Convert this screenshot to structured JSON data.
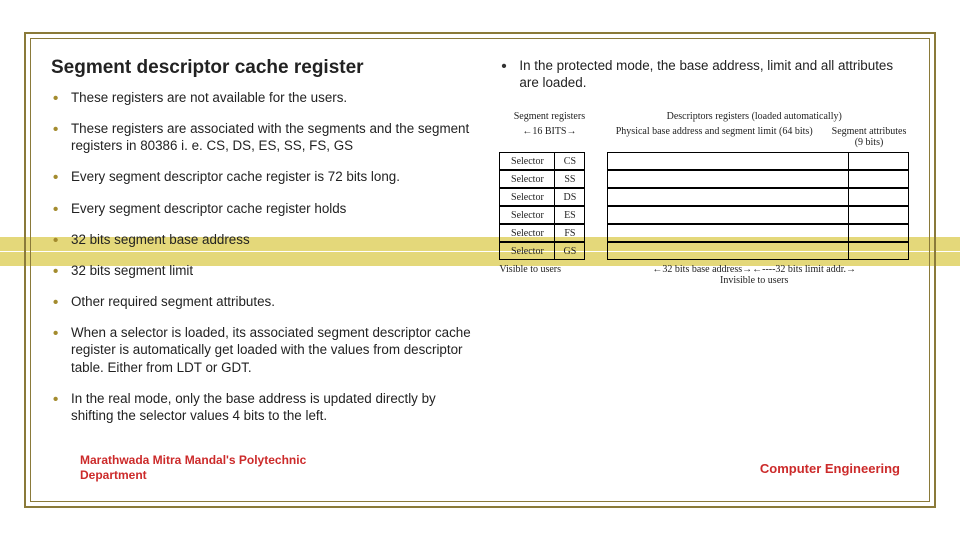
{
  "title": "Segment descriptor cache register",
  "left_bullets": [
    "These registers are not available for the users.",
    "These registers are associated with the segments and the segment registers in 80386 i. e. CS, DS, ES, SS, FS, GS",
    "Every segment descriptor cache register is 72 bits long.",
    "Every segment descriptor cache register holds",
    "32 bits segment base address",
    "32 bits segment limit",
    "Other required segment attributes.",
    "When a selector is loaded, its associated segment descriptor cache register is automatically get loaded with the values from descriptor table. Either from LDT or GDT.",
    "In the real mode, only the base address is updated directly by shifting the selector values 4 bits to the left."
  ],
  "right_bullets": [
    "In the protected mode, the base address, limit and all attributes are loaded."
  ],
  "diagram": {
    "hdr_left": "Segment registers",
    "hdr_right": "Descriptors registers (loaded automatically)",
    "sub_left": "←16 BITS→",
    "sub_base": "Physical base address and segment limit (64 bits)",
    "sub_attr": "Segment attributes (9 bits)",
    "rows": [
      {
        "sel": "Selector",
        "reg": "CS"
      },
      {
        "sel": "Selector",
        "reg": "SS"
      },
      {
        "sel": "Selector",
        "reg": "DS"
      },
      {
        "sel": "Selector",
        "reg": "ES"
      },
      {
        "sel": "Selector",
        "reg": "FS"
      },
      {
        "sel": "Selector",
        "reg": "GS"
      }
    ],
    "bottom_left": "Visible to users",
    "bottom_right": "←32 bits base address→←----32 bits limit addr.→\nInvisible to users"
  },
  "footer_left": "Marathwada Mitra Mandal's Polytechnic\nDepartment",
  "footer_right": "Computer Engineering"
}
